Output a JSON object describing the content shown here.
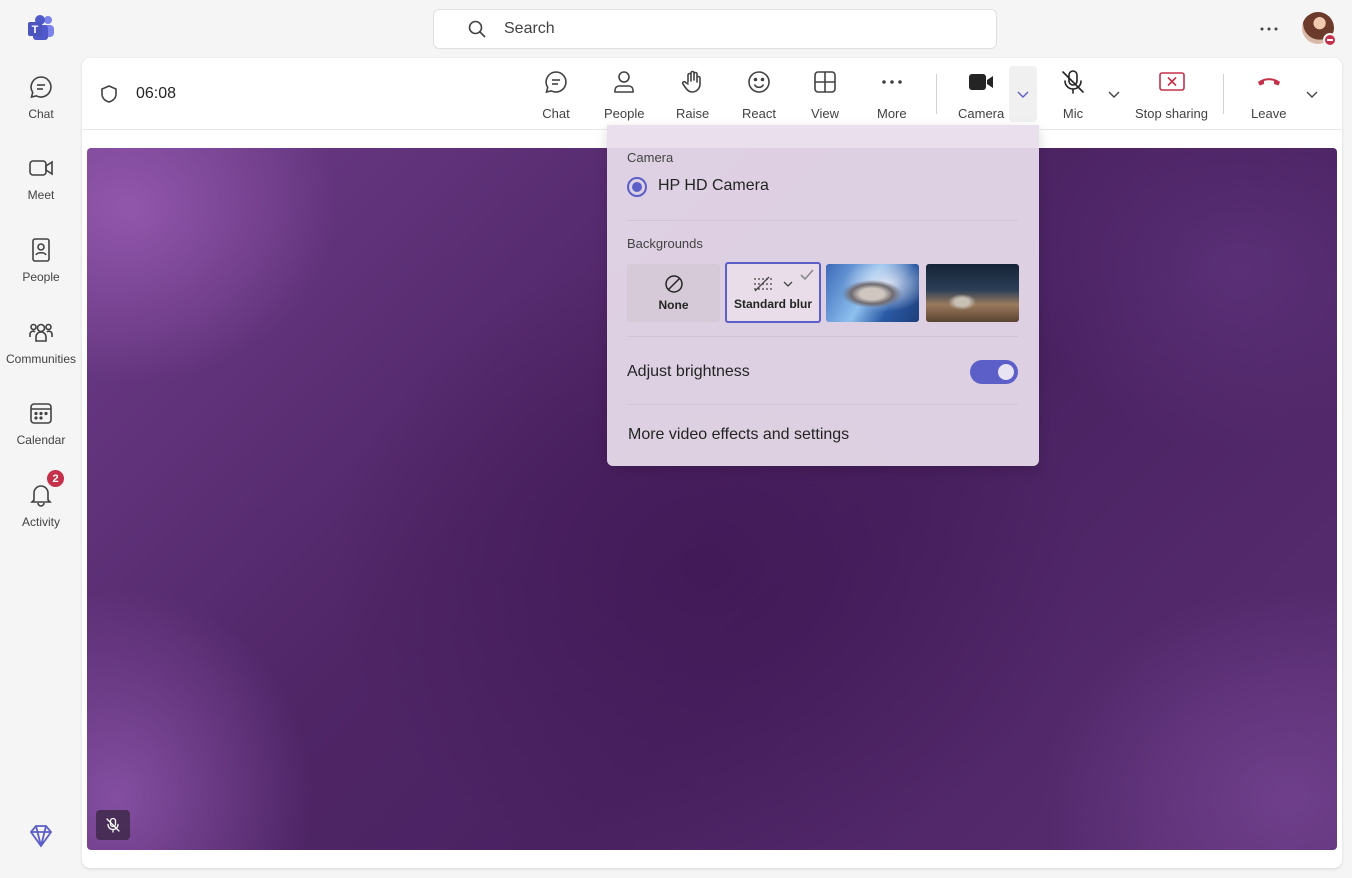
{
  "search": {
    "placeholder": "Search"
  },
  "rail": {
    "items": [
      {
        "label": "Chat"
      },
      {
        "label": "Meet"
      },
      {
        "label": "People"
      },
      {
        "label": "Communities"
      },
      {
        "label": "Calendar"
      },
      {
        "label": "Activity",
        "badge": "2"
      }
    ]
  },
  "meeting": {
    "timer": "06:08",
    "toolbar": {
      "chat": "Chat",
      "people": "People",
      "raise": "Raise",
      "react": "React",
      "view": "View",
      "more": "More",
      "camera": "Camera",
      "mic": "Mic",
      "stop_sharing": "Stop sharing",
      "leave": "Leave"
    }
  },
  "camera_menu": {
    "camera_heading": "Camera",
    "camera_device": "HP HD Camera",
    "backgrounds_heading": "Backgrounds",
    "bg_none": "None",
    "bg_blur": "Standard blur",
    "adjust_brightness": "Adjust brightness",
    "brightness_on": true,
    "more_effects": "More video effects and settings"
  },
  "colors": {
    "accent": "#5b5fc7",
    "leave_red": "#c4314b",
    "stop_share_red": "#c4314b"
  }
}
